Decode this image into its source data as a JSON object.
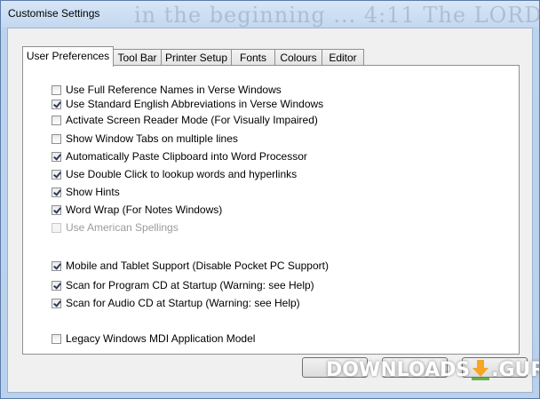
{
  "window": {
    "title": "Customise Settings",
    "background_text": "in the beginning  ... 4:11 The LORD"
  },
  "tabs": [
    {
      "label": "User Preferences",
      "active": true
    },
    {
      "label": "Tool Bar",
      "active": false
    },
    {
      "label": "Printer Setup",
      "active": false
    },
    {
      "label": "Fonts",
      "active": false
    },
    {
      "label": "Colours",
      "active": false
    },
    {
      "label": "Editor",
      "active": false
    }
  ],
  "options": [
    {
      "label": "Use Full Reference Names in Verse Windows",
      "checked": false,
      "enabled": true
    },
    {
      "label": "Use Standard English Abbreviations in Verse Windows",
      "checked": true,
      "enabled": true
    },
    {
      "label": "Activate Screen Reader Mode (For Visually Impaired)",
      "checked": false,
      "enabled": true
    },
    {
      "label": "Show Window Tabs on multiple lines",
      "checked": false,
      "enabled": true
    },
    {
      "label": "Automatically Paste Clipboard into Word Processor",
      "checked": true,
      "enabled": true
    },
    {
      "label": "Use Double Click to lookup words and hyperlinks",
      "checked": true,
      "enabled": true
    },
    {
      "label": "Show Hints",
      "checked": true,
      "enabled": true
    },
    {
      "label": "Word Wrap (For Notes Windows)",
      "checked": true,
      "enabled": true
    },
    {
      "label": "Use American Spellings",
      "checked": false,
      "enabled": false
    },
    {
      "label": "Mobile and Tablet Support (Disable Pocket PC Support)",
      "checked": true,
      "enabled": true
    },
    {
      "label": "Scan for Program CD at Startup (Warning: see Help)",
      "checked": true,
      "enabled": true
    },
    {
      "label": "Scan for Audio CD at Startup (Warning: see Help)",
      "checked": true,
      "enabled": true
    },
    {
      "label": "Legacy Windows MDI Application Model",
      "checked": false,
      "enabled": true
    }
  ],
  "watermark": {
    "left": "DOWNLOADS",
    "right": ".GURU"
  },
  "colors": {
    "accent": "#f5a623",
    "checkmark": "#2a3a5a",
    "disabled_text": "#9b9b9b"
  }
}
